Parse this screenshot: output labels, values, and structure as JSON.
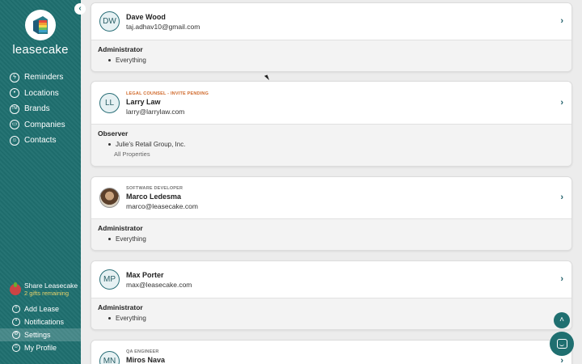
{
  "sidebar": {
    "brand": "leasecake",
    "collapse_icon": "chevron-left-icon",
    "nav": [
      {
        "label": "Reminders",
        "icon": "lightning-icon",
        "glyph": "ϟ"
      },
      {
        "label": "Locations",
        "icon": "pin-icon",
        "glyph": "•"
      },
      {
        "label": "Brands",
        "icon": "trademark-icon",
        "glyph": "TM"
      },
      {
        "label": "Companies",
        "icon": "briefcase-icon",
        "glyph": "▭"
      },
      {
        "label": "Contacts",
        "icon": "contacts-icon",
        "glyph": "☺"
      }
    ],
    "share": {
      "title": "Share Leasecake",
      "subtitle": "2 gifts remaining"
    },
    "bottom_nav": [
      {
        "label": "Add Lease",
        "icon": "plus-icon",
        "glyph": "+"
      },
      {
        "label": "Notifications",
        "icon": "bell-icon",
        "glyph": "•"
      },
      {
        "label": "Settings",
        "icon": "gear-icon",
        "glyph": "⚙"
      },
      {
        "label": "My Profile",
        "icon": "user-icon",
        "glyph": "☺"
      }
    ],
    "active_bottom": "Settings"
  },
  "users": [
    {
      "initials": "DW",
      "tag": "",
      "name": "Dave Wood",
      "email": "taj.adhav10@gmail.com",
      "role": "Administrator",
      "permissions": [
        "Everything"
      ],
      "sub": ""
    },
    {
      "initials": "LL",
      "tag": "LEGAL COUNSEL - INVITE PENDING",
      "name": "Larry Law",
      "email": "larry@larrylaw.com",
      "role": "Observer",
      "permissions": [
        "Julie's Retail Group, Inc."
      ],
      "sub": "All Properties"
    },
    {
      "initials": "",
      "tag": "SOFTWARE DEVELOPER",
      "name": "Marco Ledesma",
      "email": "marco@leasecake.com",
      "role": "Administrator",
      "permissions": [
        "Everything"
      ],
      "sub": ""
    },
    {
      "initials": "MP",
      "tag": "",
      "name": "Max Porter",
      "email": "max@leasecake.com",
      "role": "Administrator",
      "permissions": [
        "Everything"
      ],
      "sub": ""
    },
    {
      "initials": "MN",
      "tag": "QA ENGINEER",
      "name": "Miros Nava",
      "email": "",
      "role": "",
      "permissions": [],
      "sub": ""
    }
  ],
  "colors": {
    "sidebar": "#1f6f70",
    "accent": "#1f6f70",
    "pending_tag": "#d06a2c"
  },
  "scroll_top_icon": "chevron-up-icon",
  "chat_icon": "chat-icon"
}
